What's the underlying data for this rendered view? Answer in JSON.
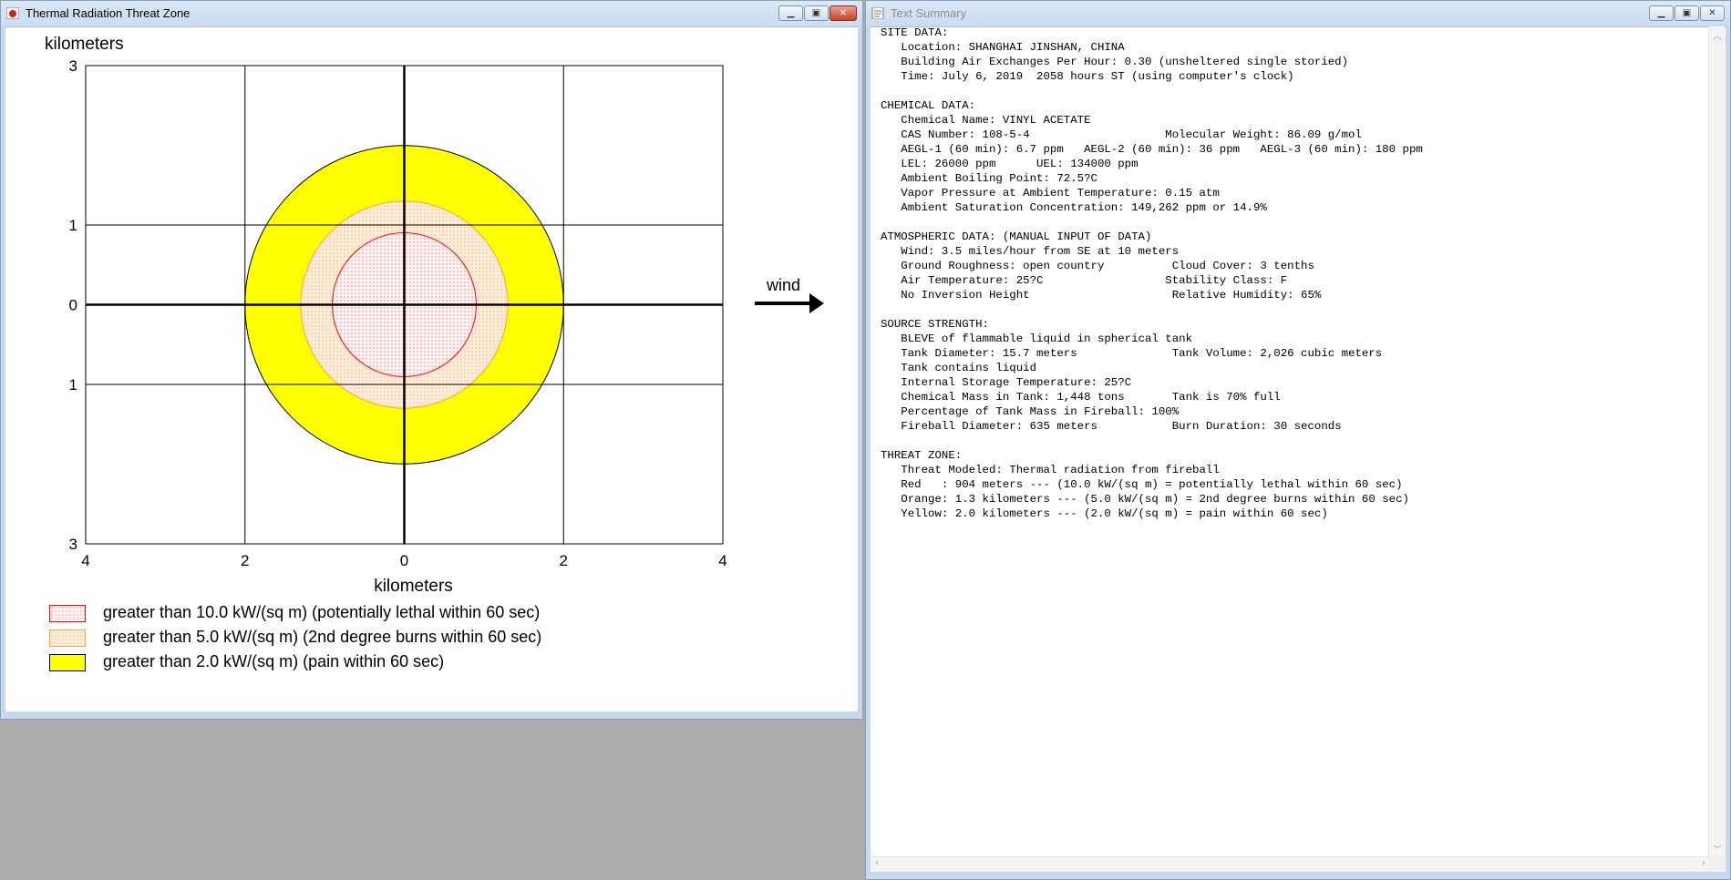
{
  "threat_window": {
    "title": "Thermal Radiation Threat Zone",
    "y_axis_title": "kilometers",
    "x_axis_title": "kilometers",
    "y_tick_labels": [
      "3",
      "1",
      "0",
      "1",
      "3"
    ],
    "x_tick_labels": [
      "4",
      "2",
      "0",
      "2",
      "4"
    ],
    "wind_label": "wind",
    "legend": [
      {
        "label": "greater than 10.0 kW/(sq m) (potentially lethal within 60 sec)",
        "color": "#ff0000"
      },
      {
        "label": "greater than 5.0 kW/(sq m) (2nd degree burns within 60 sec)",
        "color": "#ffa040"
      },
      {
        "label": "greater than 2.0 kW/(sq m) (pain within 60 sec)",
        "color": "#ffff00"
      }
    ]
  },
  "chart_data": {
    "type": "threat-zone-map",
    "xlabel": "kilometers",
    "ylabel": "kilometers",
    "xlim": [
      -4,
      4
    ],
    "ylim": [
      -3,
      3
    ],
    "grid": true,
    "wind_direction": "east",
    "zones": [
      {
        "name": "Red",
        "radius_km": 0.904,
        "color": "#ff0000",
        "fill": "#fff2f2",
        "pattern": "dots"
      },
      {
        "name": "Orange",
        "radius_km": 1.3,
        "color": "#ffa040",
        "fill": "#ffecd9",
        "pattern": "dots"
      },
      {
        "name": "Yellow",
        "radius_km": 2.0,
        "color": "#ffff00",
        "fill": "#ffff00",
        "pattern": "solid"
      }
    ]
  },
  "summary_window": {
    "title": "Text Summary",
    "lines": [
      "SITE DATA:",
      "   Location: SHANGHAI JINSHAN, CHINA",
      "   Building Air Exchanges Per Hour: 0.30 (unsheltered single storied)",
      "   Time: July 6, 2019  2058 hours ST (using computer's clock)",
      "",
      "CHEMICAL DATA:",
      "   Chemical Name: VINYL ACETATE",
      "   CAS Number: 108-5-4                    Molecular Weight: 86.09 g/mol",
      "   AEGL-1 (60 min): 6.7 ppm   AEGL-2 (60 min): 36 ppm   AEGL-3 (60 min): 180 ppm",
      "   LEL: 26000 ppm      UEL: 134000 ppm",
      "   Ambient Boiling Point: 72.5?C",
      "   Vapor Pressure at Ambient Temperature: 0.15 atm",
      "   Ambient Saturation Concentration: 149,262 ppm or 14.9%",
      "",
      "ATMOSPHERIC DATA: (MANUAL INPUT OF DATA)",
      "   Wind: 3.5 miles/hour from SE at 10 meters",
      "   Ground Roughness: open country          Cloud Cover: 3 tenths",
      "   Air Temperature: 25?C                  Stability Class: F",
      "   No Inversion Height                     Relative Humidity: 65%",
      "",
      "SOURCE STRENGTH:",
      "   BLEVE of flammable liquid in spherical tank",
      "   Tank Diameter: 15.7 meters              Tank Volume: 2,026 cubic meters",
      "   Tank contains liquid",
      "   Internal Storage Temperature: 25?C",
      "   Chemical Mass in Tank: 1,448 tons       Tank is 70% full",
      "   Percentage of Tank Mass in Fireball: 100%",
      "   Fireball Diameter: 635 meters           Burn Duration: 30 seconds",
      "",
      "THREAT ZONE:",
      "   Threat Modeled: Thermal radiation from fireball",
      "   Red   : 904 meters --- (10.0 kW/(sq m) = potentially lethal within 60 sec)",
      "   Orange: 1.3 kilometers --- (5.0 kW/(sq m) = 2nd degree burns within 60 sec)",
      "   Yellow: 2.0 kilometers --- (2.0 kW/(sq m) = pain within 60 sec)"
    ]
  }
}
